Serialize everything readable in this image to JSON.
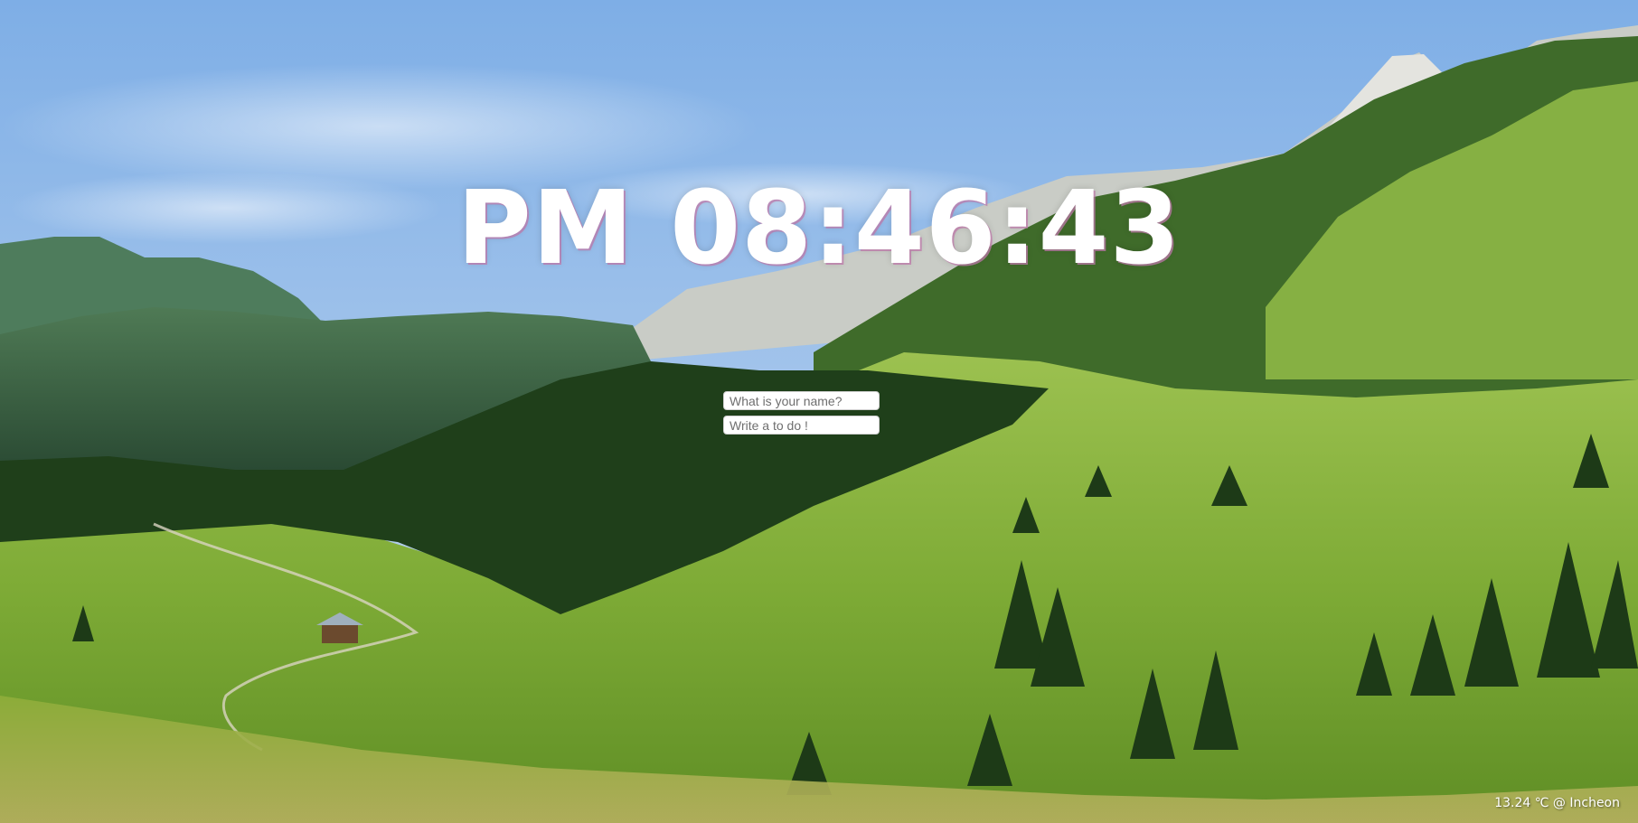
{
  "clock": {
    "text": "PM 08:46:43"
  },
  "greeting_form": {
    "name_placeholder": "What is your name?",
    "name_value": ""
  },
  "todo_form": {
    "todo_placeholder": "Write a to do !",
    "todo_value": ""
  },
  "weather": {
    "text": "13.24 ℃ @ Incheon"
  },
  "colors": {
    "clock_text": "#ffffff",
    "clock_shadow": "#be78aa",
    "input_background": "#ffffff",
    "sky": "#8fb8e6",
    "meadow": "#7fae3a",
    "forest": "#1f4a1c"
  }
}
